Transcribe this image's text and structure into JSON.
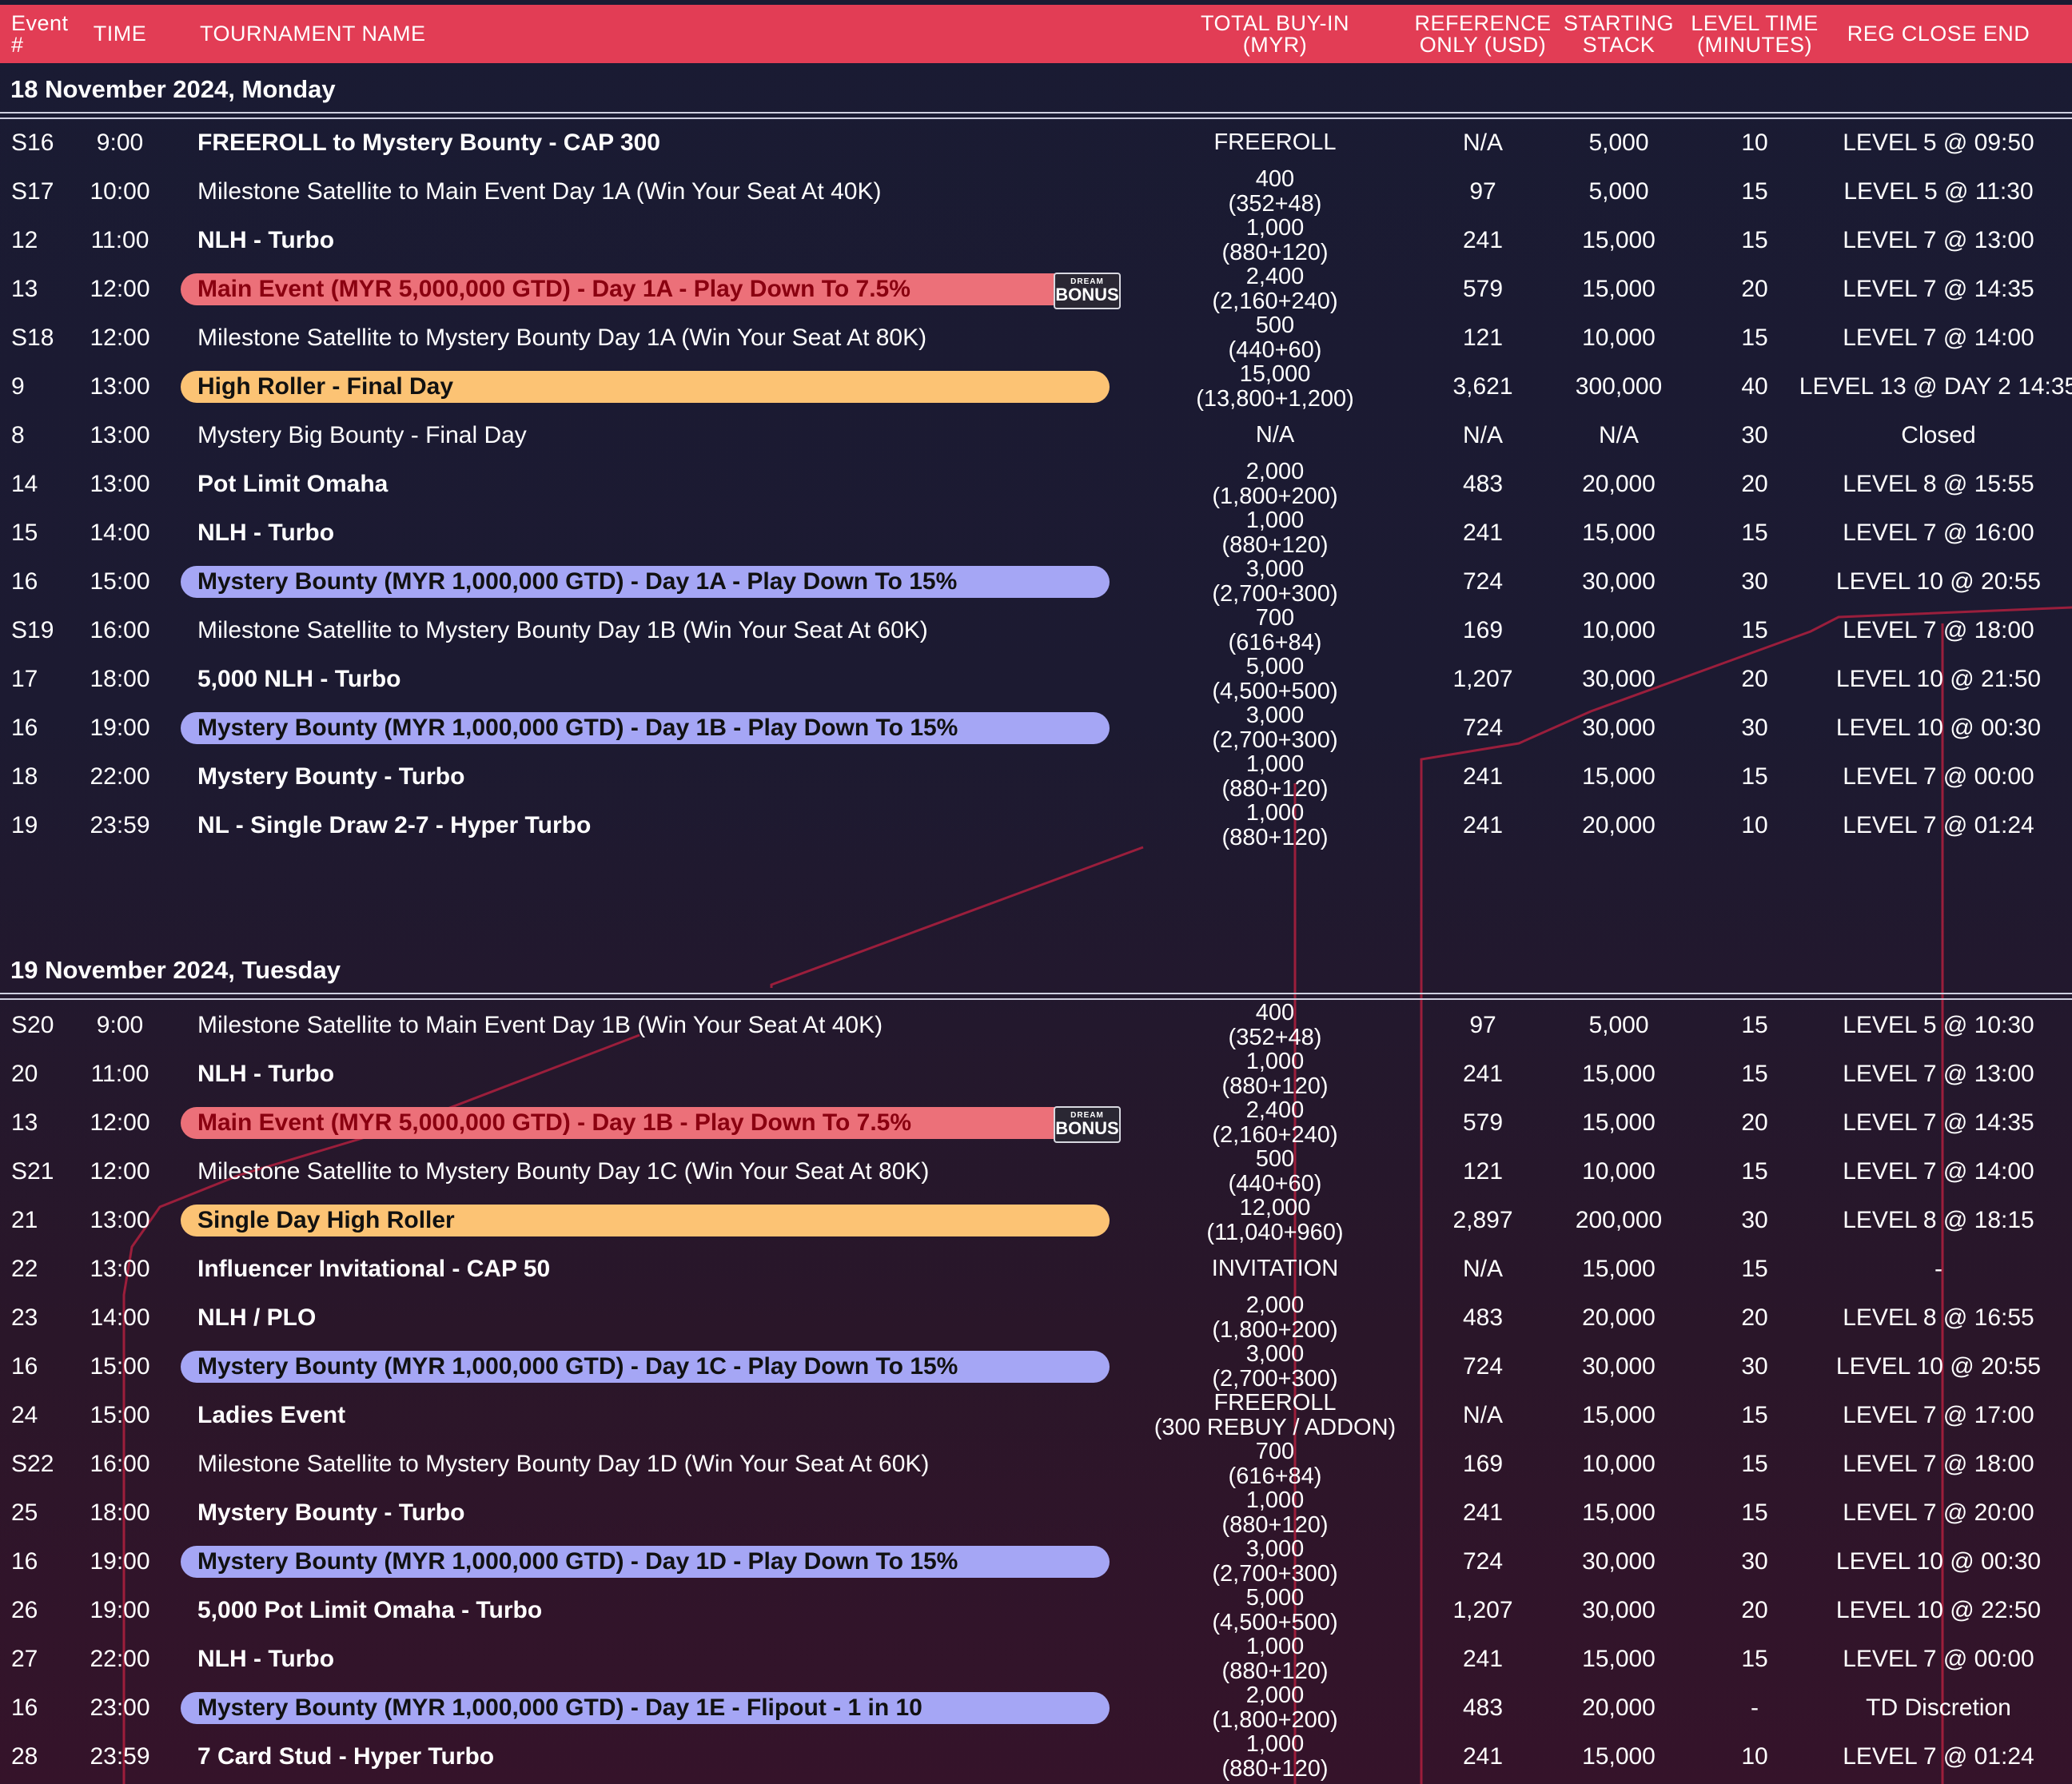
{
  "header": {
    "event": "Event\n#",
    "time": "TIME",
    "name": "TOURNAMENT NAME",
    "buyin": "TOTAL BUY-IN\n(MYR)",
    "reference": "REFERENCE\nONLY (USD)",
    "stack": "STARTING\nSTACK",
    "level_time": "LEVEL TIME\n(MINUTES)",
    "reg_close": "REG CLOSE END"
  },
  "badge": {
    "top": "DREAM",
    "bottom": "BONUS"
  },
  "colors": {
    "header": "#e23d55",
    "red_pill": "#ec7079",
    "yellow_pill": "#fcc374",
    "purple_pill": "#a5a6f5"
  },
  "days": [
    {
      "date": "18 November 2024, Monday",
      "rows": [
        {
          "ev": "S16",
          "time": "9:00",
          "name": "FREEROLL to Mystery Bounty - CAP 300",
          "bold": true,
          "buyin": "FREEROLL",
          "buyin2": "",
          "ref": "N/A",
          "stack": "5,000",
          "lvl": "10",
          "reg": "LEVEL 5 @ 09:50"
        },
        {
          "ev": "S17",
          "time": "10:00",
          "name": "Milestone Satellite to Main Event Day 1A (Win Your Seat At 40K)",
          "bold": false,
          "buyin": "400",
          "buyin2": "(352+48)",
          "ref": "97",
          "stack": "5,000",
          "lvl": "15",
          "reg": "LEVEL 5 @ 11:30"
        },
        {
          "ev": "12",
          "time": "11:00",
          "name": "NLH - Turbo",
          "bold": true,
          "buyin": "1,000",
          "buyin2": "(880+120)",
          "ref": "241",
          "stack": "15,000",
          "lvl": "15",
          "reg": "LEVEL 7 @ 13:00"
        },
        {
          "ev": "13",
          "time": "12:00",
          "name": "Main Event (MYR 5,000,000 GTD) - Day 1A - Play Down To 7.5%",
          "bold": true,
          "pill": "red",
          "badge": true,
          "buyin": "2,400",
          "buyin2": "(2,160+240)",
          "ref": "579",
          "stack": "15,000",
          "lvl": "20",
          "reg": "LEVEL 7 @ 14:35"
        },
        {
          "ev": "S18",
          "time": "12:00",
          "name": "Milestone Satellite to Mystery Bounty Day 1A (Win Your Seat At 80K)",
          "bold": false,
          "buyin": "500",
          "buyin2": "(440+60)",
          "ref": "121",
          "stack": "10,000",
          "lvl": "15",
          "reg": "LEVEL 7 @ 14:00"
        },
        {
          "ev": "9",
          "time": "13:00",
          "name": "High Roller - Final Day",
          "bold": true,
          "pill": "yellow",
          "buyin": "15,000",
          "buyin2": "(13,800+1,200)",
          "ref": "3,621",
          "stack": "300,000",
          "lvl": "40",
          "reg": "LEVEL 13 @ DAY 2 14:35"
        },
        {
          "ev": "8",
          "time": "13:00",
          "name": "Mystery Big Bounty - Final Day",
          "bold": false,
          "buyin": "N/A",
          "buyin2": "",
          "ref": "N/A",
          "stack": "N/A",
          "lvl": "30",
          "reg": "Closed"
        },
        {
          "ev": "14",
          "time": "13:00",
          "name": "Pot Limit Omaha",
          "bold": true,
          "buyin": "2,000",
          "buyin2": "(1,800+200)",
          "ref": "483",
          "stack": "20,000",
          "lvl": "20",
          "reg": "LEVEL 8 @ 15:55"
        },
        {
          "ev": "15",
          "time": "14:00",
          "name": "NLH - Turbo",
          "bold": true,
          "buyin": "1,000",
          "buyin2": "(880+120)",
          "ref": "241",
          "stack": "15,000",
          "lvl": "15",
          "reg": "LEVEL 7 @ 16:00"
        },
        {
          "ev": "16",
          "time": "15:00",
          "name": "Mystery Bounty (MYR 1,000,000 GTD) - Day 1A - Play Down To 15%",
          "bold": true,
          "pill": "purple",
          "buyin": "3,000",
          "buyin2": "(2,700+300)",
          "ref": "724",
          "stack": "30,000",
          "lvl": "30",
          "reg": "LEVEL 10 @ 20:55"
        },
        {
          "ev": "S19",
          "time": "16:00",
          "name": "Milestone Satellite to Mystery Bounty Day 1B (Win Your Seat At 60K)",
          "bold": false,
          "buyin": "700",
          "buyin2": "(616+84)",
          "ref": "169",
          "stack": "10,000",
          "lvl": "15",
          "reg": "LEVEL 7 @ 18:00"
        },
        {
          "ev": "17",
          "time": "18:00",
          "name": "5,000 NLH - Turbo",
          "bold": true,
          "buyin": "5,000",
          "buyin2": "(4,500+500)",
          "ref": "1,207",
          "stack": "30,000",
          "lvl": "20",
          "reg": "LEVEL 10 @ 21:50"
        },
        {
          "ev": "16",
          "time": "19:00",
          "name": "Mystery Bounty (MYR 1,000,000 GTD) - Day 1B - Play Down To 15%",
          "bold": true,
          "pill": "purple",
          "buyin": "3,000",
          "buyin2": "(2,700+300)",
          "ref": "724",
          "stack": "30,000",
          "lvl": "30",
          "reg": "LEVEL 10 @ 00:30"
        },
        {
          "ev": "18",
          "time": "22:00",
          "name": "Mystery Bounty - Turbo",
          "bold": true,
          "buyin": "1,000",
          "buyin2": "(880+120)",
          "ref": "241",
          "stack": "15,000",
          "lvl": "15",
          "reg": "LEVEL 7 @ 00:00"
        },
        {
          "ev": "19",
          "time": "23:59",
          "name": "NL - Single Draw 2-7 - Hyper Turbo",
          "bold": true,
          "buyin": "1,000",
          "buyin2": "(880+120)",
          "ref": "241",
          "stack": "20,000",
          "lvl": "10",
          "reg": "LEVEL 7 @ 01:24"
        }
      ]
    },
    {
      "date": "19 November 2024, Tuesday",
      "rows": [
        {
          "ev": "S20",
          "time": "9:00",
          "name": "Milestone Satellite to Main Event Day 1B (Win Your Seat At 40K)",
          "bold": false,
          "buyin": "400",
          "buyin2": "(352+48)",
          "ref": "97",
          "stack": "5,000",
          "lvl": "15",
          "reg": "LEVEL 5 @ 10:30"
        },
        {
          "ev": "20",
          "time": "11:00",
          "name": "NLH - Turbo",
          "bold": true,
          "buyin": "1,000",
          "buyin2": "(880+120)",
          "ref": "241",
          "stack": "15,000",
          "lvl": "15",
          "reg": "LEVEL 7 @ 13:00"
        },
        {
          "ev": "13",
          "time": "12:00",
          "name": "Main Event (MYR 5,000,000 GTD) - Day 1B - Play Down To 7.5%",
          "bold": true,
          "pill": "red",
          "badge": true,
          "buyin": "2,400",
          "buyin2": "(2,160+240)",
          "ref": "579",
          "stack": "15,000",
          "lvl": "20",
          "reg": "LEVEL 7 @ 14:35"
        },
        {
          "ev": "S21",
          "time": "12:00",
          "name": "Milestone Satellite to Mystery Bounty Day 1C (Win Your Seat At 80K)",
          "bold": false,
          "buyin": "500",
          "buyin2": "(440+60)",
          "ref": "121",
          "stack": "10,000",
          "lvl": "15",
          "reg": "LEVEL 7 @ 14:00"
        },
        {
          "ev": "21",
          "time": "13:00",
          "name": "Single Day High Roller",
          "bold": true,
          "pill": "yellow",
          "buyin": "12,000",
          "buyin2": "(11,040+960)",
          "ref": "2,897",
          "stack": "200,000",
          "lvl": "30",
          "reg": "LEVEL 8 @ 18:15"
        },
        {
          "ev": "22",
          "time": "13:00",
          "name": "Influencer Invitational - CAP 50",
          "bold": true,
          "buyin": "INVITATION",
          "buyin2": "",
          "ref": "N/A",
          "stack": "15,000",
          "lvl": "15",
          "reg": "-"
        },
        {
          "ev": "23",
          "time": "14:00",
          "name": "NLH / PLO",
          "bold": true,
          "buyin": "2,000",
          "buyin2": "(1,800+200)",
          "ref": "483",
          "stack": "20,000",
          "lvl": "20",
          "reg": "LEVEL 8 @ 16:55"
        },
        {
          "ev": "16",
          "time": "15:00",
          "name": "Mystery Bounty (MYR 1,000,000 GTD) - Day 1C - Play Down To 15%",
          "bold": true,
          "pill": "purple",
          "buyin": "3,000",
          "buyin2": "(2,700+300)",
          "ref": "724",
          "stack": "30,000",
          "lvl": "30",
          "reg": "LEVEL 10 @ 20:55"
        },
        {
          "ev": "24",
          "time": "15:00",
          "name": "Ladies Event",
          "bold": true,
          "buyin": "FREEROLL",
          "buyin2": "(300 REBUY / ADDON)",
          "ref": "N/A",
          "stack": "15,000",
          "lvl": "15",
          "reg": "LEVEL 7 @ 17:00"
        },
        {
          "ev": "S22",
          "time": "16:00",
          "name": "Milestone Satellite to Mystery Bounty Day 1D (Win Your Seat At 60K)",
          "bold": false,
          "buyin": "700",
          "buyin2": "(616+84)",
          "ref": "169",
          "stack": "10,000",
          "lvl": "15",
          "reg": "LEVEL 7 @ 18:00"
        },
        {
          "ev": "25",
          "time": "18:00",
          "name": "Mystery Bounty - Turbo",
          "bold": true,
          "buyin": "1,000",
          "buyin2": "(880+120)",
          "ref": "241",
          "stack": "15,000",
          "lvl": "15",
          "reg": "LEVEL 7 @ 20:00"
        },
        {
          "ev": "16",
          "time": "19:00",
          "name": "Mystery Bounty (MYR 1,000,000 GTD) - Day 1D - Play Down To 15%",
          "bold": true,
          "pill": "purple",
          "buyin": "3,000",
          "buyin2": "(2,700+300)",
          "ref": "724",
          "stack": "30,000",
          "lvl": "30",
          "reg": "LEVEL 10 @ 00:30"
        },
        {
          "ev": "26",
          "time": "19:00",
          "name": "5,000 Pot Limit Omaha - Turbo",
          "bold": true,
          "buyin": "5,000",
          "buyin2": "(4,500+500)",
          "ref": "1,207",
          "stack": "30,000",
          "lvl": "20",
          "reg": "LEVEL 10 @ 22:50"
        },
        {
          "ev": "27",
          "time": "22:00",
          "name": "NLH - Turbo",
          "bold": true,
          "buyin": "1,000",
          "buyin2": "(880+120)",
          "ref": "241",
          "stack": "15,000",
          "lvl": "15",
          "reg": "LEVEL 7 @ 00:00"
        },
        {
          "ev": "16",
          "time": "23:00",
          "name": "Mystery Bounty (MYR 1,000,000 GTD) - Day 1E - Flipout - 1 in 10",
          "bold": true,
          "pill": "purple",
          "buyin": "2,000",
          "buyin2": "(1,800+200)",
          "ref": "483",
          "stack": "20,000",
          "lvl": "-",
          "reg": "TD Discretion"
        },
        {
          "ev": "28",
          "time": "23:59",
          "name": "7 Card Stud - Hyper Turbo",
          "bold": true,
          "buyin": "1,000",
          "buyin2": "(880+120)",
          "ref": "241",
          "stack": "15,000",
          "lvl": "10",
          "reg": "LEVEL 7 @ 01:24"
        }
      ]
    }
  ]
}
